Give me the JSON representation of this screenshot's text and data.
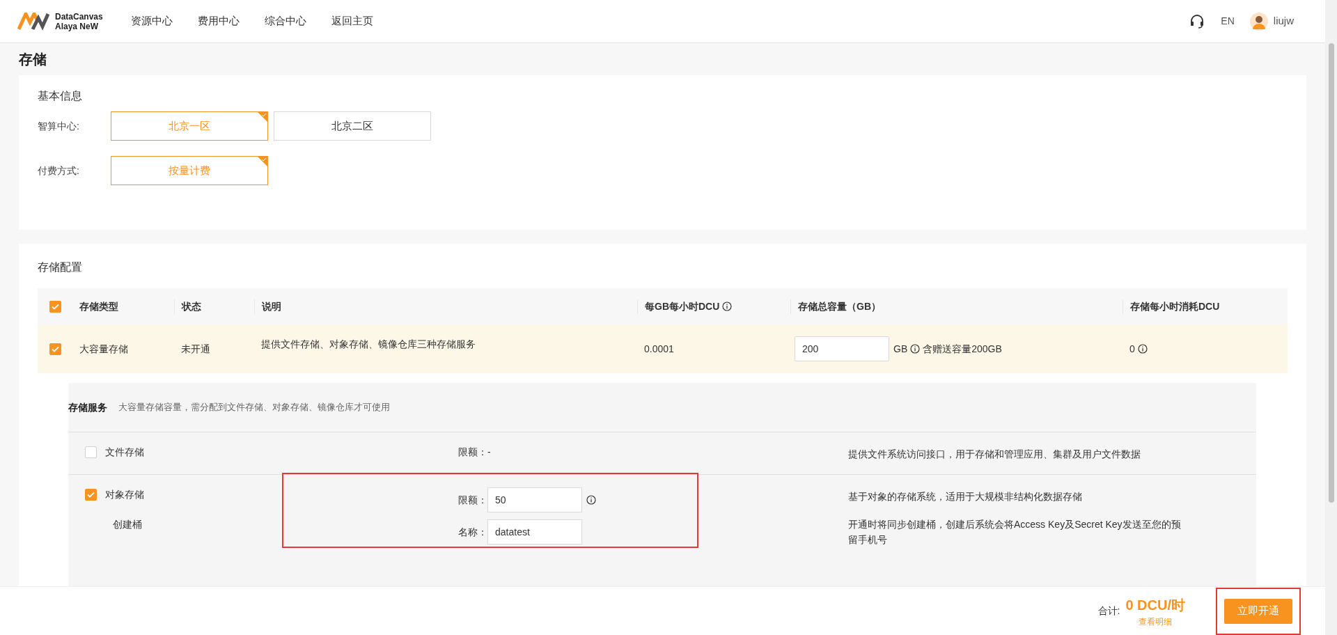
{
  "header": {
    "logo_line1": "DataCanvas",
    "logo_line2": "Alaya NeW",
    "nav": [
      "资源中心",
      "费用中心",
      "综合中心",
      "返回主页"
    ],
    "language": "EN",
    "user": "liujw"
  },
  "page_title": "存储",
  "basic_info": {
    "title": "基本信息",
    "fields": [
      {
        "label": "智算中心:",
        "options": [
          {
            "label": "北京一区",
            "selected": true
          },
          {
            "label": "北京二区",
            "selected": false
          }
        ]
      },
      {
        "label": "付费方式:",
        "options": [
          {
            "label": "按量计费",
            "selected": true
          }
        ]
      }
    ]
  },
  "storage_config": {
    "title": "存储配置",
    "header_checked": true,
    "columns": [
      {
        "kind": "plain",
        "label": "存储类型"
      },
      {
        "kind": "plain",
        "label": "状态"
      },
      {
        "kind": "plain",
        "label": "说明"
      },
      {
        "kind": "info",
        "label": "每GB每小时DCU"
      },
      {
        "kind": "plain",
        "label": "存储总容量（GB）"
      },
      {
        "kind": "plain",
        "label": "存储每小时消耗DCU"
      }
    ],
    "rows": [
      {
        "checked": true,
        "type": "大容量存储",
        "status": "未开通",
        "description": "提供文件存储、对象存储、镜像仓库三种存储服务",
        "price": "0.0001",
        "capacity": "200",
        "capacity_unit": "GB",
        "capacity_note": "含赠送容量200GB",
        "consumption": "0"
      }
    ]
  },
  "services": {
    "title": "存储服务",
    "hint": "大容量存储容量，需分配到文件存储、对象存储、镜像仓库才可使用",
    "items": [
      {
        "kind": "text",
        "checked": false,
        "name": "文件存储",
        "quota_label": "限额：",
        "quota_value": "-",
        "descriptions": [
          "提供文件系统访问接口，用于存储和管理应用、集群及用户文件数据"
        ]
      },
      {
        "kind": "input",
        "checked": true,
        "name": "对象存储",
        "sub_label": "创建桶",
        "quota_label": "限额：",
        "quota_value": "50",
        "name_label": "名称：",
        "name_value": "datatest",
        "descriptions": [
          "基于对象的存储系统，适用于大规模非结构化数据存储",
          "开通时将同步创建桶，创建后系统会将Access Key及Secret Key发送至您的预留手机号"
        ]
      }
    ]
  },
  "footer": {
    "total_label": "合计:",
    "total": "0 DCU/时",
    "detail_link": "查看明细",
    "submit": "立即开通"
  }
}
